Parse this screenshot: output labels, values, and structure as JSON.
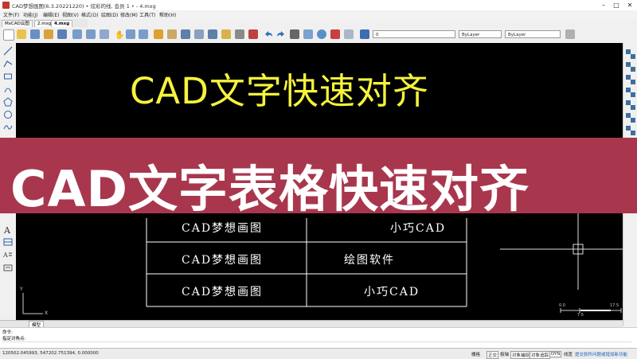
{
  "window": {
    "title": "CAD梦想画图(6.3.20221220)  •  炫彩的线,  会员 1  •  - 4.mxg"
  },
  "menu": [
    "文件(F)",
    "功能(J)",
    "编辑(E)",
    "视图(V)",
    "格式(O)",
    "绘图(D)",
    "修改(M)",
    "工具(T)",
    "帮助(H)"
  ],
  "tabs": [
    "MxCAD云图",
    "2.mxg*",
    "4.mxg"
  ],
  "toolbar": {
    "layer_combo": "0",
    "color_combo": "ByLayer",
    "linetype_combo": "ByLayer"
  },
  "drawing": {
    "heading": "CAD文字快速对齐",
    "banner": "CAD文字表格快速对齐",
    "table_rows": [
      {
        "left": "CAD梦想画图",
        "right": "小巧CAD"
      },
      {
        "left": "CAD梦想画图",
        "right": "绘图软件"
      },
      {
        "left": "CAD梦想画图",
        "right": "小巧CAD"
      }
    ],
    "ucs": {
      "x": "X",
      "y": "Y"
    },
    "scale_labels": [
      "0.0",
      "7.5",
      "17.5"
    ]
  },
  "model_tab": "模型",
  "command": {
    "line1": "命令:",
    "line2": "指定对角点:"
  },
  "status": {
    "coords": "120502.045993,  547202.751394,  0.000000",
    "buttons": [
      "栅格",
      "正交",
      "极轴",
      "对象捕捉",
      "对象追踪",
      "DYN",
      "线宽",
      "提交软件问题或增加新功能"
    ]
  }
}
